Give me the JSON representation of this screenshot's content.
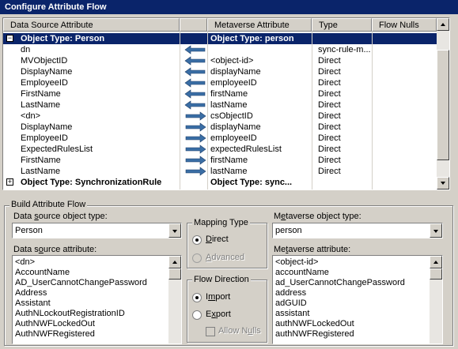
{
  "window": {
    "title": "Configure Attribute Flow"
  },
  "grid": {
    "headers": [
      "Data Source Attribute",
      "",
      "Metaverse Attribute",
      "Type",
      "Flow Nulls"
    ],
    "rows": [
      {
        "kind": "group",
        "expander": "−",
        "source": "Object Type: Person",
        "direction": "",
        "target": "Object Type: person",
        "type": "",
        "selected": true
      },
      {
        "kind": "mapping",
        "source": "dn",
        "direction": "import",
        "target": "",
        "type": "sync-rule-m..."
      },
      {
        "kind": "mapping",
        "source": "MVObjectID",
        "direction": "import",
        "target": "<object-id>",
        "type": "Direct"
      },
      {
        "kind": "mapping",
        "source": "DisplayName",
        "direction": "import",
        "target": "displayName",
        "type": "Direct"
      },
      {
        "kind": "mapping",
        "source": "EmployeeID",
        "direction": "import",
        "target": "employeeID",
        "type": "Direct"
      },
      {
        "kind": "mapping",
        "source": "FirstName",
        "direction": "import",
        "target": "firstName",
        "type": "Direct"
      },
      {
        "kind": "mapping",
        "source": "LastName",
        "direction": "import",
        "target": "lastName",
        "type": "Direct"
      },
      {
        "kind": "mapping",
        "source": "<dn>",
        "direction": "export",
        "target": "csObjectID",
        "type": "Direct"
      },
      {
        "kind": "mapping",
        "source": "DisplayName",
        "direction": "export",
        "target": "displayName",
        "type": "Direct"
      },
      {
        "kind": "mapping",
        "source": "EmployeeID",
        "direction": "export",
        "target": "employeeID",
        "type": "Direct"
      },
      {
        "kind": "mapping",
        "source": "ExpectedRulesList",
        "direction": "export",
        "target": "expectedRulesList",
        "type": "Direct"
      },
      {
        "kind": "mapping",
        "source": "FirstName",
        "direction": "export",
        "target": "firstName",
        "type": "Direct"
      },
      {
        "kind": "mapping",
        "source": "LastName",
        "direction": "export",
        "target": "lastName",
        "type": "Direct"
      },
      {
        "kind": "group",
        "expander": "+",
        "source": "Object Type: SynchronizationRule",
        "direction": "",
        "target": "Object Type: sync...",
        "type": "",
        "selected": false
      }
    ]
  },
  "build": {
    "title": "Build Attribute Flow",
    "ds_type_label_pre": "Data ",
    "ds_type_label_key": "s",
    "ds_type_label_post": "ource object type:",
    "ds_type_value": "Person",
    "mv_type_label_pre": "M",
    "mv_type_label_key": "e",
    "mv_type_label_post": "taverse object type:",
    "mv_type_value": "person",
    "ds_attr_label_pre": "Data s",
    "ds_attr_label_key": "o",
    "ds_attr_label_post": "urce attribute:",
    "ds_attributes": [
      "<dn>",
      "AccountName",
      "AD_UserCannotChangePassword",
      "Address",
      "Assistant",
      "AuthNLockoutRegistrationID",
      "AuthNWFLockedOut",
      "AuthNWFRegistered"
    ],
    "mv_attr_label_pre": "Me",
    "mv_attr_label_key": "t",
    "mv_attr_label_post": "averse attribute:",
    "mv_attributes": [
      "<object-id>",
      "accountName",
      "ad_UserCannotChangePassword",
      "address",
      "adGUID",
      "assistant",
      "authNWFLockedOut",
      "authNWFRegistered"
    ],
    "mapping_type": {
      "title": "Mapping Type",
      "direct_pre": "",
      "direct_key": "D",
      "direct_post": "irect",
      "advanced_pre": "",
      "advanced_key": "A",
      "advanced_post": "dvanced",
      "selected": "Direct"
    },
    "flow_direction": {
      "title": "Flow Direction",
      "import_pre": "I",
      "import_key": "m",
      "import_post": "port",
      "export_pre": "E",
      "export_key": "x",
      "export_post": "port",
      "allow_nulls_pre": "Allow N",
      "allow_nulls_key": "u",
      "allow_nulls_post": "lls",
      "selected": "Import"
    }
  },
  "colors": {
    "selection": "#0a246a",
    "face": "#d4d0c8",
    "arrow": "#3a6ea5"
  }
}
